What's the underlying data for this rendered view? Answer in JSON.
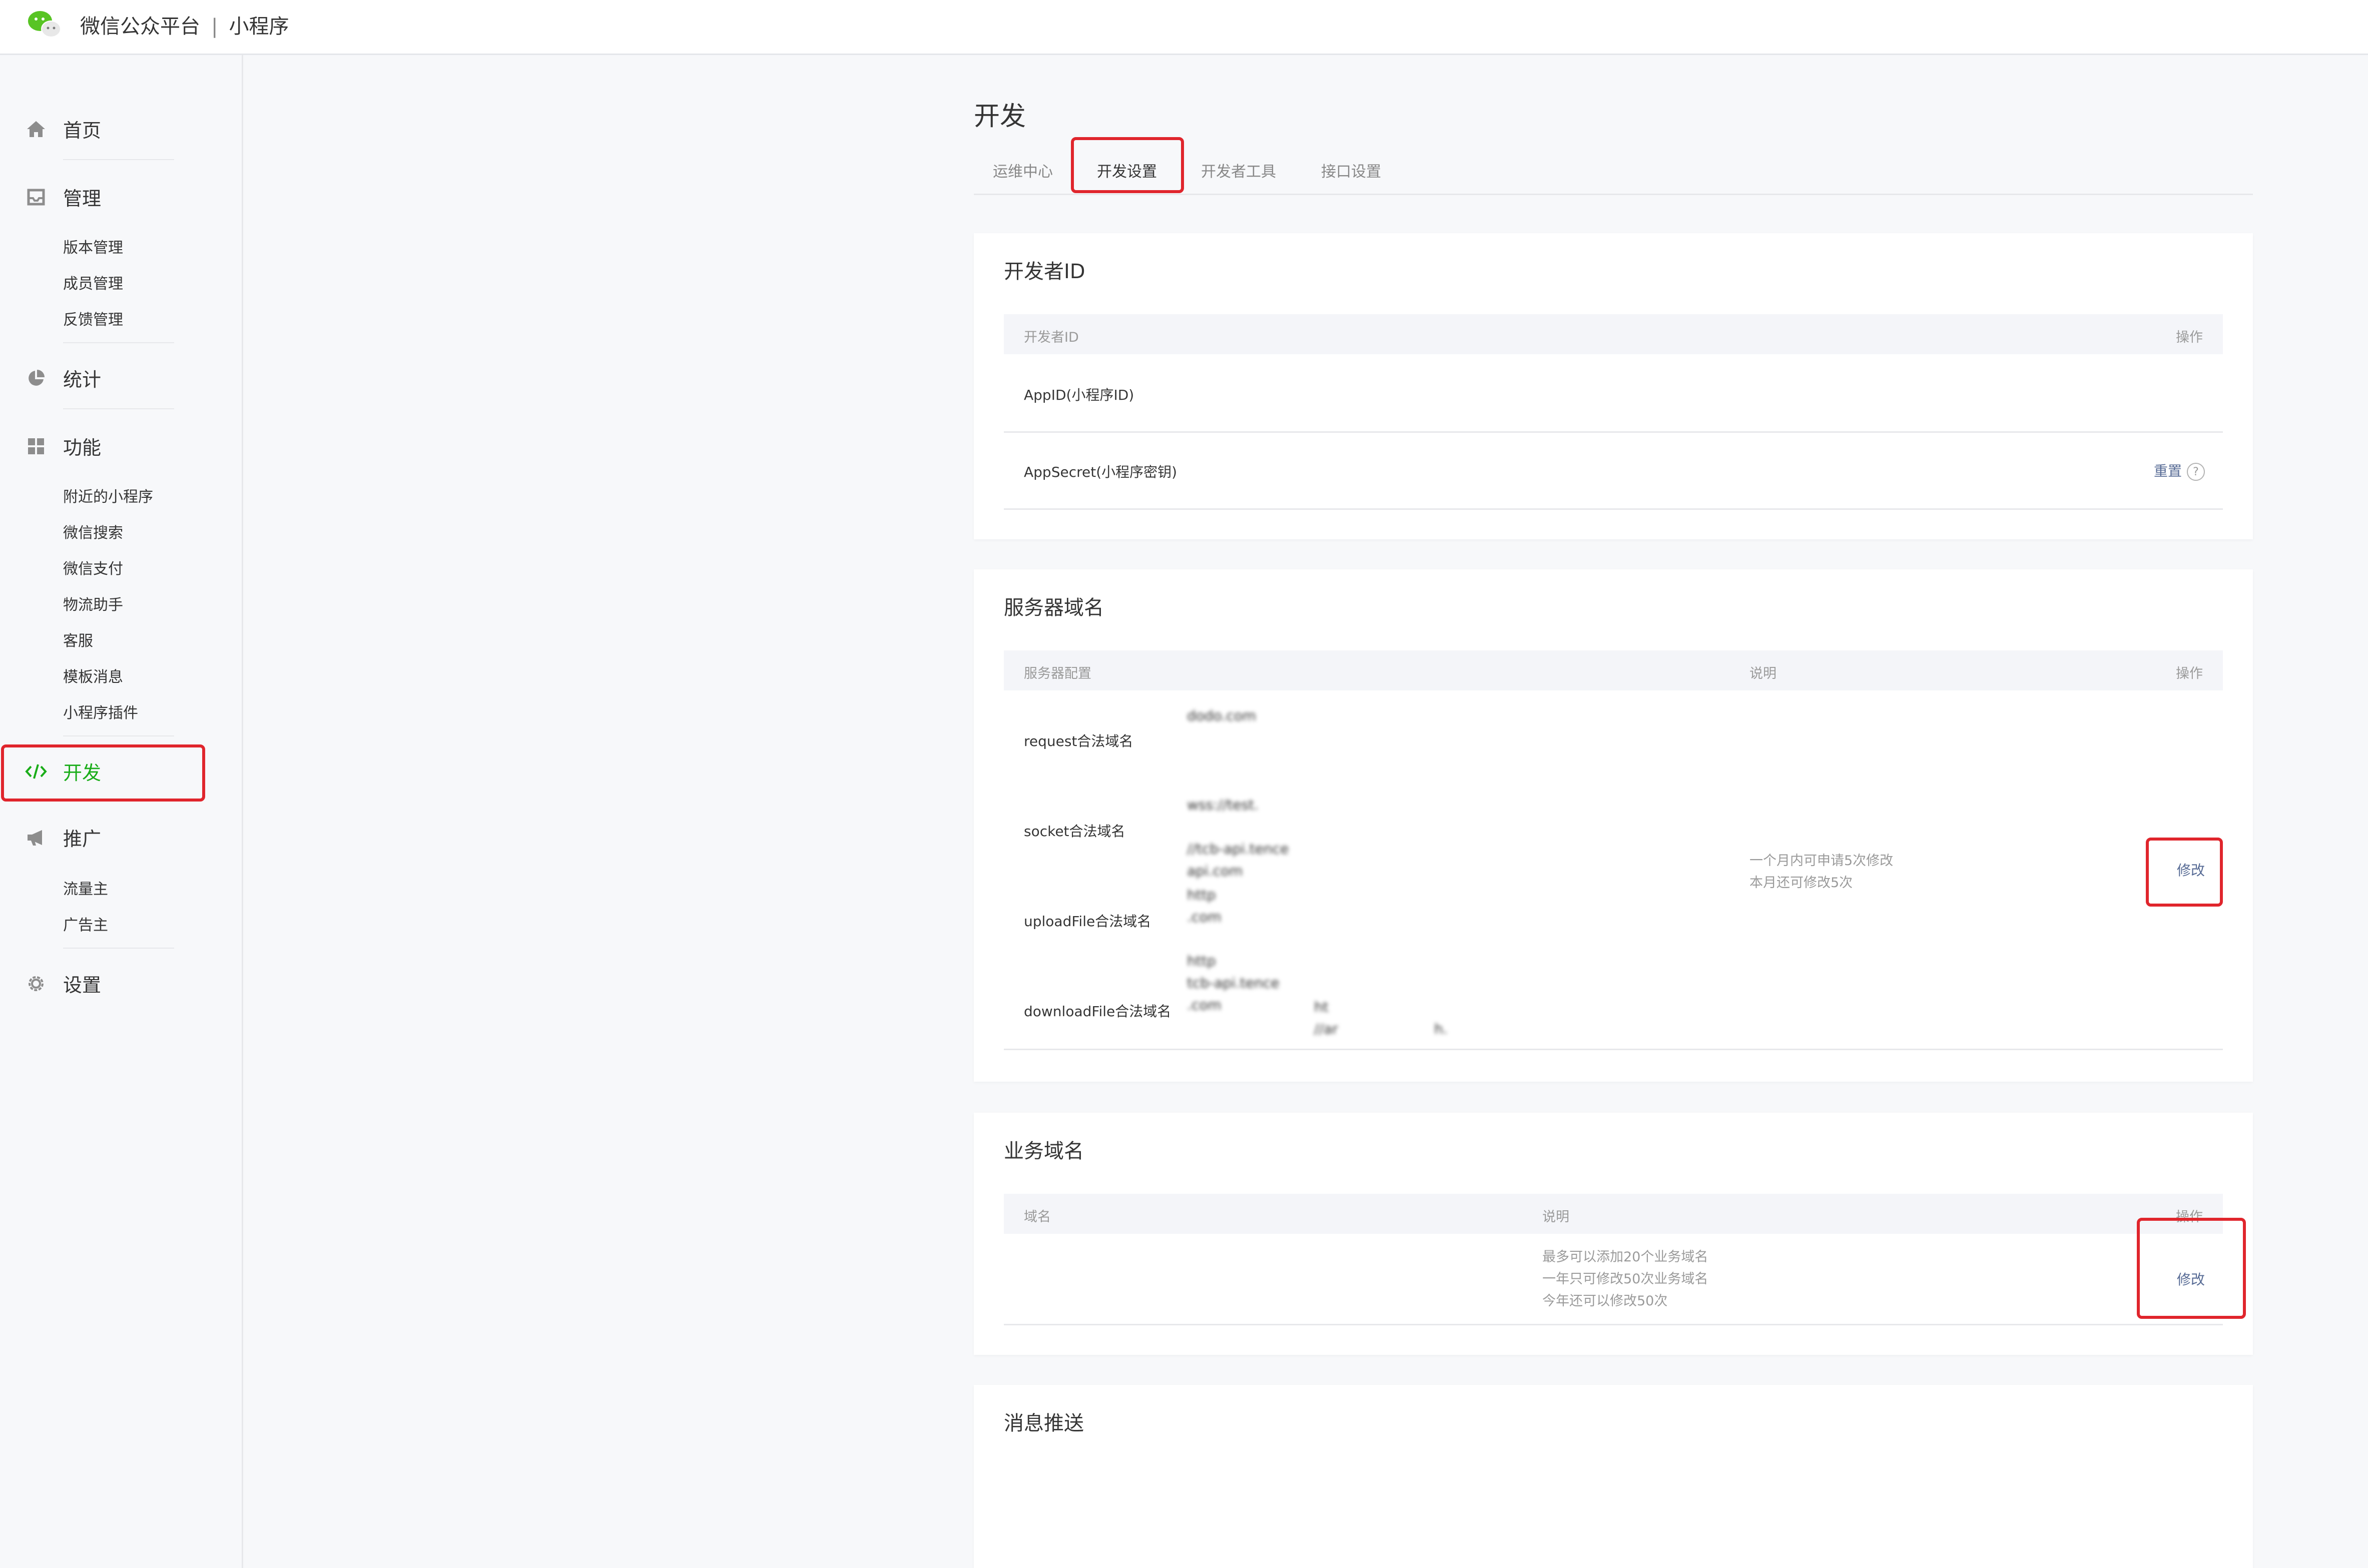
{
  "header": {
    "platform": "微信公众平台",
    "separator": "|",
    "product": "小程序"
  },
  "sidebar": {
    "home": "首页",
    "manage": "管理",
    "manage_items": [
      "版本管理",
      "成员管理",
      "反馈管理"
    ],
    "stats": "统计",
    "features": "功能",
    "feature_items": [
      "附近的小程序",
      "微信搜索",
      "微信支付",
      "物流助手",
      "客服",
      "模板消息",
      "小程序插件"
    ],
    "develop": "开发",
    "promote": "推广",
    "promote_items": [
      "流量主",
      "广告主"
    ],
    "settings": "设置",
    "active_color": "#1aad19"
  },
  "page": {
    "title": "开发"
  },
  "tabs": [
    "运维中心",
    "开发设置",
    "开发者工具",
    "接口设置"
  ],
  "developer_id": {
    "title": "开发者ID",
    "col_name": "开发者ID",
    "col_action": "操作",
    "appid_label": "AppID(小程序ID)",
    "appid_value": "",
    "secret_label": "AppSecret(小程序密钥)",
    "secret_action": "重置",
    "help_icon": "?"
  },
  "server_domain": {
    "title": "服务器域名",
    "col_config": "服务器配置",
    "col_desc": "说明",
    "col_action": "操作",
    "rows": [
      {
        "label": "request合法域名",
        "values": [
          "dodo.com",
          "",
          ""
        ]
      },
      {
        "label": "socket合法域名",
        "values": [
          "wss://test.",
          "",
          "//tcb-api.tence",
          "api.com"
        ]
      },
      {
        "label": "uploadFile合法域名",
        "values": [
          "http",
          ".com",
          "",
          "http",
          "tcb-api.tence",
          ".com"
        ]
      },
      {
        "label": "downloadFile合法域名",
        "values": [
          "",
          "ht",
          "//ar",
          "h."
        ]
      }
    ],
    "desc_line1": "一个月内可申请5次修改",
    "desc_line2": "本月还可修改5次",
    "action": "修改"
  },
  "business_domain": {
    "title": "业务域名",
    "col_domain": "域名",
    "col_desc": "说明",
    "col_action": "操作",
    "domain_value": "",
    "desc_line1": "最多可以添加20个业务域名",
    "desc_line2": "一年只可修改50次业务域名",
    "desc_line3": "今年还可以修改50次",
    "action": "修改"
  },
  "message_push": {
    "title": "消息推送"
  },
  "highlight_color": "#e0252c",
  "link_color": "#576b95"
}
